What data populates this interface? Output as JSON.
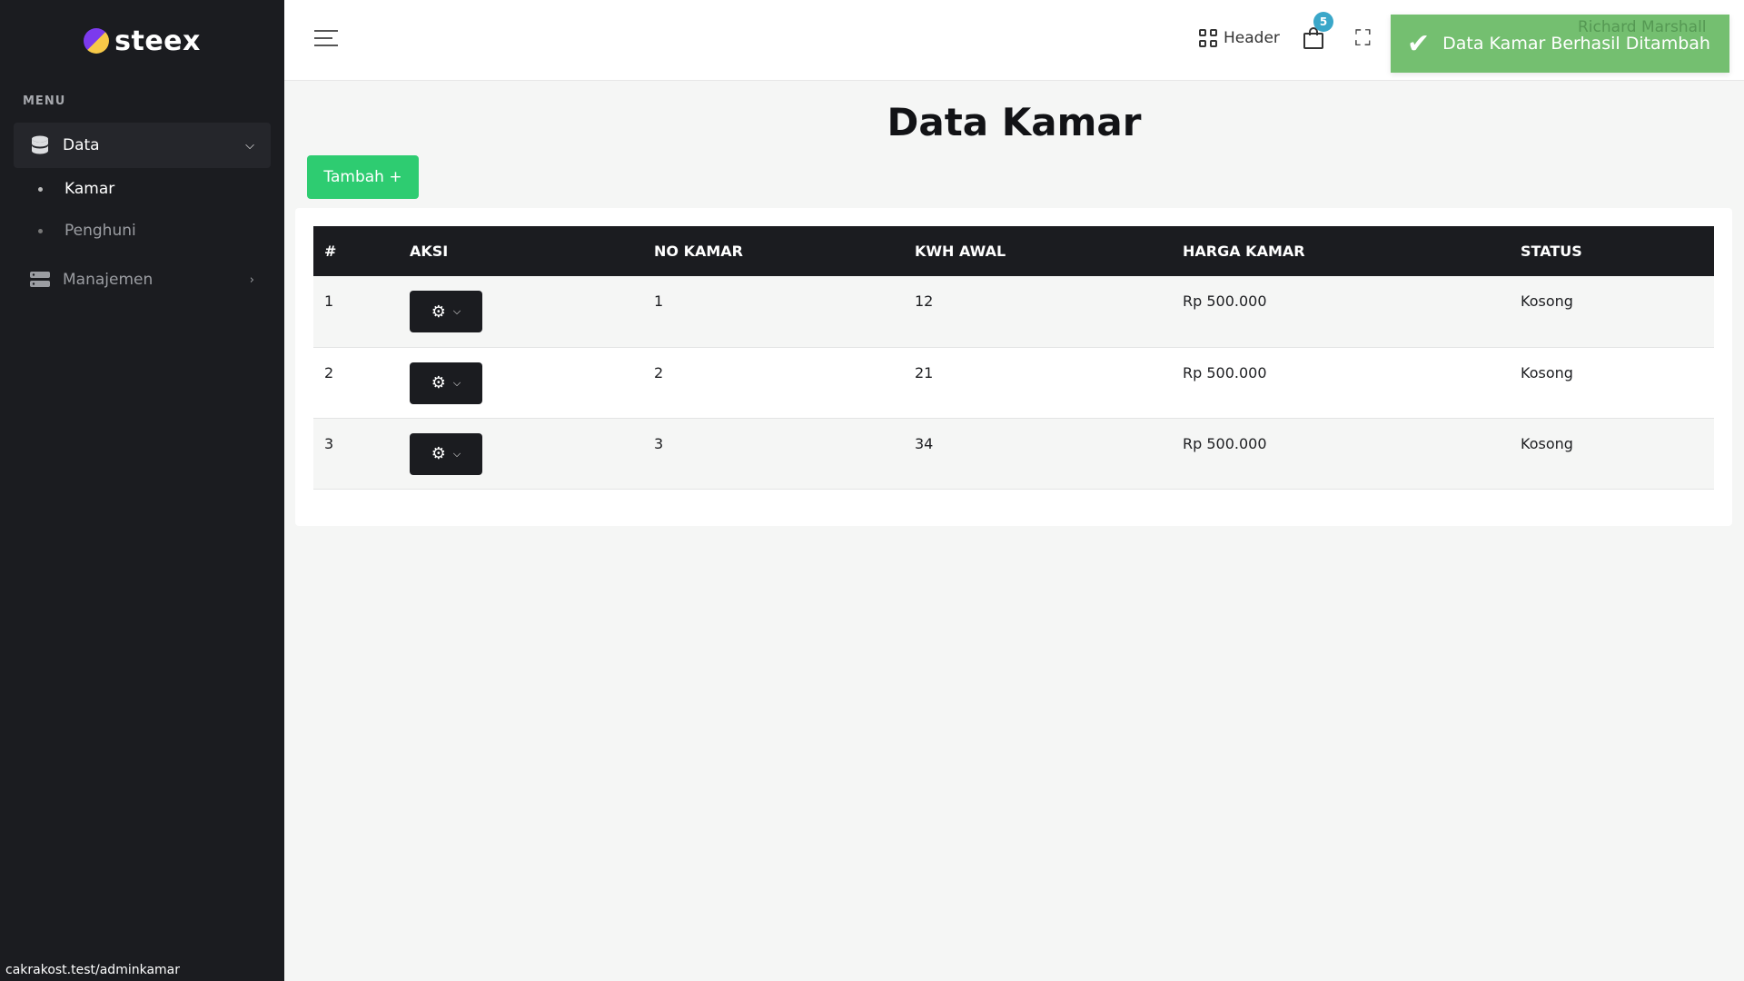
{
  "sidebar": {
    "brand": "steex",
    "menu_title": "MENU",
    "items": [
      {
        "label": "Data",
        "icon": "database-icon",
        "expanded": true,
        "children": [
          {
            "label": "Kamar",
            "active": true
          },
          {
            "label": "Penghuni",
            "active": false
          }
        ]
      },
      {
        "label": "Manajemen",
        "icon": "server-icon",
        "expanded": false
      }
    ]
  },
  "header": {
    "broken_image_alt": "Header",
    "cart_badge": "5"
  },
  "toast": {
    "message": "Data Kamar Berhasil Ditambah",
    "ghost_user": "Richard Marshall",
    "color": "#68ba64"
  },
  "main": {
    "title": "Data Kamar",
    "add_button": "Tambah +",
    "table": {
      "columns": [
        "#",
        "AKSI",
        "NO KAMAR",
        "KWH AWAL",
        "HARGA KAMAR",
        "STATUS"
      ],
      "rows": [
        {
          "no": "1",
          "no_kamar": "1",
          "kwh_awal": "12",
          "harga": "Rp 500.000",
          "status": "Kosong"
        },
        {
          "no": "2",
          "no_kamar": "2",
          "kwh_awal": "21",
          "harga": "Rp 500.000",
          "status": "Kosong"
        },
        {
          "no": "3",
          "no_kamar": "3",
          "kwh_awal": "34",
          "harga": "Rp 500.000",
          "status": "Kosong"
        }
      ]
    }
  },
  "statusbar": {
    "url": "cakrakost.test/adminkamar"
  },
  "colors": {
    "sidebar_bg": "#1b1c20",
    "accent_green": "#2ecc71",
    "badge_blue": "#3aa7c9"
  }
}
